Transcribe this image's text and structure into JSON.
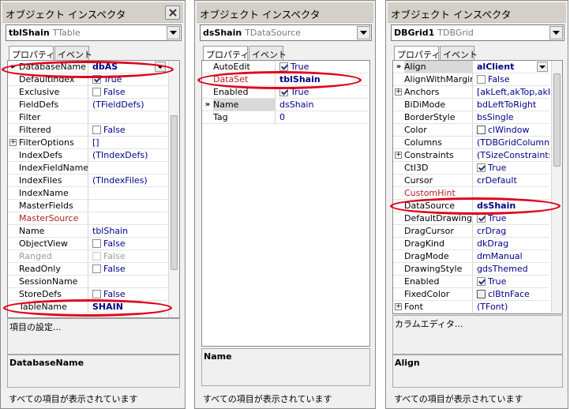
{
  "panels": [
    {
      "title": "オブジェクト インスペクタ",
      "component": {
        "name": "tblShain",
        "type": "TTable"
      },
      "tabs": {
        "properties": "プロパティ",
        "events": "イベント"
      },
      "rows": [
        {
          "name": "DatabaseName",
          "value": "dbAS",
          "bold": true,
          "marker": "tri",
          "dropdown": true
        },
        {
          "name": "DefaultIndex",
          "value": "True",
          "check": "checked"
        },
        {
          "name": "Exclusive",
          "value": "False",
          "check": "unchecked"
        },
        {
          "name": "FieldDefs",
          "value": "(TFieldDefs)"
        },
        {
          "name": "Filter",
          "value": ""
        },
        {
          "name": "Filtered",
          "value": "False",
          "check": "unchecked"
        },
        {
          "name": "FilterOptions",
          "value": "[]",
          "marker": "plus"
        },
        {
          "name": "IndexDefs",
          "value": "(TIndexDefs)"
        },
        {
          "name": "IndexFieldName",
          "value": ""
        },
        {
          "name": "IndexFiles",
          "value": "(TIndexFiles)"
        },
        {
          "name": "IndexName",
          "value": ""
        },
        {
          "name": "MasterFields",
          "value": ""
        },
        {
          "name": "MasterSource",
          "value": "",
          "nameColor": "red"
        },
        {
          "name": "Name",
          "value": "tblShain"
        },
        {
          "name": "ObjectView",
          "value": "False",
          "check": "unchecked"
        },
        {
          "name": "Ranged",
          "value": "False",
          "check": "disabled",
          "nameColor": "gray",
          "valueColor": "gray"
        },
        {
          "name": "ReadOnly",
          "value": "False",
          "check": "unchecked"
        },
        {
          "name": "SessionName",
          "value": ""
        },
        {
          "name": "StoreDefs",
          "value": "False",
          "check": "unchecked"
        },
        {
          "name": "TableName",
          "value": "SHAIN",
          "bold": true
        }
      ],
      "description_action": "項目の設定...",
      "description_property": "DatabaseName",
      "status": "すべての項目が表示されています"
    },
    {
      "title": "オブジェクト インスペクタ",
      "component": {
        "name": "dsShain",
        "type": "TDataSource"
      },
      "tabs": {
        "properties": "プロパティ",
        "events": "イベント"
      },
      "rows": [
        {
          "name": "AutoEdit",
          "value": "True",
          "check": "checked"
        },
        {
          "name": "DataSet",
          "value": "tblShain",
          "bold": true,
          "nameColor": "red"
        },
        {
          "name": "Enabled",
          "value": "True",
          "check": "checked"
        },
        {
          "name": "Name",
          "value": "dsShain",
          "marker": "chev",
          "selected": true
        },
        {
          "name": "Tag",
          "value": "0"
        }
      ],
      "description_action": "",
      "description_property": "Name",
      "status": "すべての項目が表示されています"
    },
    {
      "title": "オブジェクト インスペクタ",
      "component": {
        "name": "DBGrid1",
        "type": "TDBGrid"
      },
      "tabs": {
        "properties": "プロパティ",
        "events": "イベント"
      },
      "rows": [
        {
          "name": "Align",
          "value": "alClient",
          "bold": true,
          "marker": "chev",
          "selected": true,
          "dropdown": true
        },
        {
          "name": "AlignWithMargin",
          "value": "False",
          "check": "unchecked"
        },
        {
          "name": "Anchors",
          "value": "[akLeft,akTop,akRight",
          "marker": "plus"
        },
        {
          "name": "BiDiMode",
          "value": "bdLeftToRight"
        },
        {
          "name": "BorderStyle",
          "value": "bsSingle"
        },
        {
          "name": "Color",
          "value": "clWindow",
          "swatch": "#ffffff"
        },
        {
          "name": "Columns",
          "value": "(TDBGridColumns)"
        },
        {
          "name": "Constraints",
          "value": "(TSizeConstraints)",
          "marker": "plus"
        },
        {
          "name": "Ctl3D",
          "value": "True",
          "check": "checked"
        },
        {
          "name": "Cursor",
          "value": "crDefault"
        },
        {
          "name": "CustomHint",
          "value": "",
          "nameColor": "red"
        },
        {
          "name": "DataSource",
          "value": "dsShain",
          "bold": true
        },
        {
          "name": "DefaultDrawing",
          "value": "True",
          "check": "checked"
        },
        {
          "name": "DragCursor",
          "value": "crDrag"
        },
        {
          "name": "DragKind",
          "value": "dkDrag"
        },
        {
          "name": "DragMode",
          "value": "dmManual"
        },
        {
          "name": "DrawingStyle",
          "value": "gdsThemed"
        },
        {
          "name": "Enabled",
          "value": "True",
          "check": "checked"
        },
        {
          "name": "FixedColor",
          "value": "clBtnFace",
          "swatch": "#f0f0f0"
        },
        {
          "name": "Font",
          "value": "(TFont)",
          "marker": "plus"
        }
      ],
      "description_action": "カラムエディタ...",
      "description_property": "Align",
      "status": "すべての項目が表示されています"
    }
  ],
  "colors": {
    "highlight_ellipse": "#e0001a",
    "value_blue": "#00008b",
    "red_property": "#b22222"
  }
}
